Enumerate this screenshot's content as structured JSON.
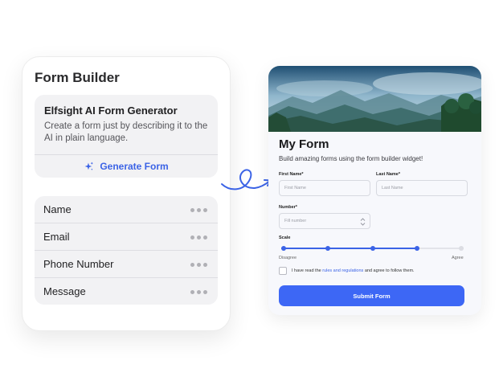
{
  "builder": {
    "title": "Form Builder",
    "ai": {
      "title": "Elfsight AI Form Generator",
      "description": "Create a form just by describing it to the AI in plain language.",
      "button_label": "Generate Form",
      "button_icon": "sparkle-icon"
    },
    "fields": [
      {
        "label": "Name",
        "menu_icon": "more-dots-icon"
      },
      {
        "label": "Email",
        "menu_icon": "more-dots-icon"
      },
      {
        "label": "Phone Number",
        "menu_icon": "more-dots-icon"
      },
      {
        "label": "Message",
        "menu_icon": "more-dots-icon"
      }
    ]
  },
  "form": {
    "title": "My Form",
    "subtitle": "Build amazing forms using the form builder widget!",
    "first_name": {
      "label": "First Name*",
      "placeholder": "First Name"
    },
    "last_name": {
      "label": "Last Name*",
      "placeholder": "Last Name"
    },
    "number": {
      "label": "Number*",
      "placeholder": "Fill number"
    },
    "scale": {
      "label": "Scale",
      "min_label": "Disagree",
      "max_label": "Agree",
      "steps": 5,
      "selected": 4
    },
    "agree": {
      "prefix": "I have read the ",
      "link": "rules and regulations",
      "suffix": " and agree to follow them.",
      "checked": false
    },
    "submit_label": "Submit Form"
  },
  "colors": {
    "accent": "#3b63e6",
    "submit": "#3d67f5"
  }
}
